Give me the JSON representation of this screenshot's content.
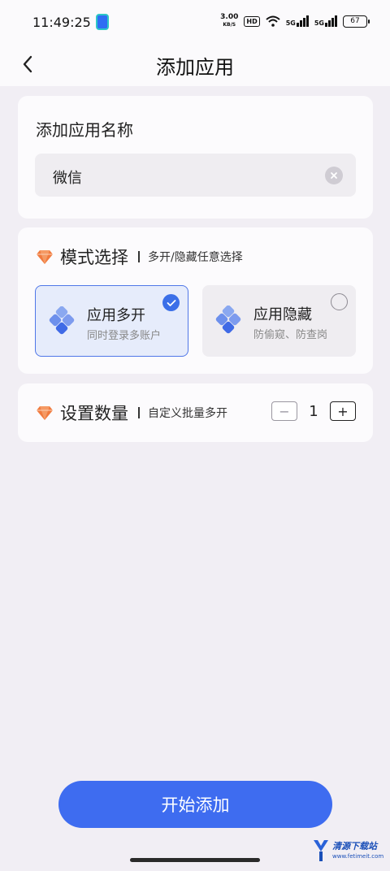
{
  "status_bar": {
    "time": "11:49:25",
    "net_speed": "3.00",
    "net_unit": "KB/S",
    "hd": "HD",
    "sim1": "5G",
    "sim2": "5G",
    "battery": "67"
  },
  "header": {
    "back_icon": "chevron-left-icon",
    "title": "添加应用"
  },
  "name_card": {
    "label": "添加应用名称",
    "value": "微信",
    "clear_icon": "clear-icon"
  },
  "mode_card": {
    "title": "模式选择",
    "subtitle": "多开/隐藏任意选择",
    "options": [
      {
        "title": "应用多开",
        "desc": "同时登录多账户",
        "selected": true
      },
      {
        "title": "应用隐藏",
        "desc": "防偷窥、防查岗",
        "selected": false
      }
    ]
  },
  "count_card": {
    "title": "设置数量",
    "subtitle": "自定义批量多开",
    "minus": "−",
    "value": "1",
    "plus": "+"
  },
  "action": {
    "start_label": "开始添加"
  },
  "watermark": {
    "text": "清源下载站",
    "url": "www.fetimeit.com"
  },
  "colors": {
    "accent": "#3e6cf0",
    "gem": "#f07a3e",
    "background": "#f1eef4"
  }
}
